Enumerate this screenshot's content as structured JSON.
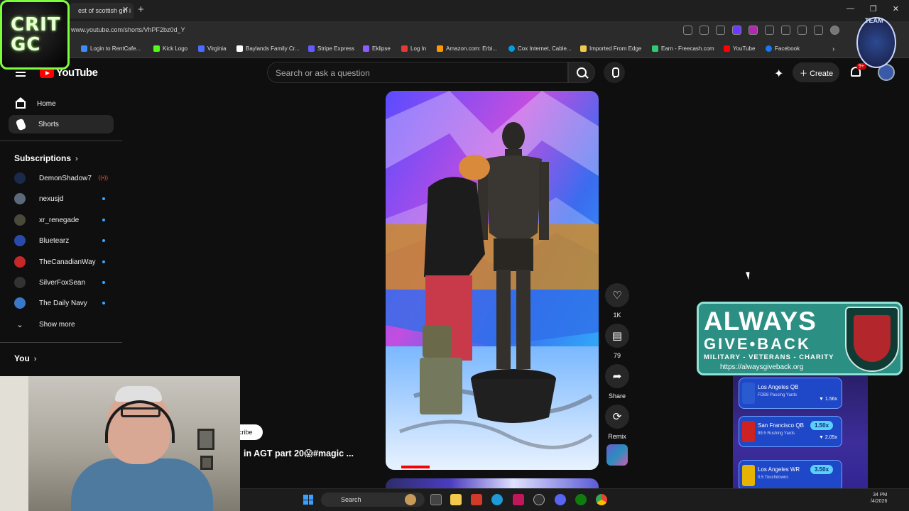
{
  "browser": {
    "tab_title": "est of scottish girl i",
    "url": "www.youtube.com/shorts/VhPF2bz0d_Y",
    "bookmarks": [
      {
        "label": "Login to RentCafe...",
        "color": "#3c8cff"
      },
      {
        "label": "Kick Logo",
        "color": "#53fc18"
      },
      {
        "label": "Virginia",
        "color": "#4a6cff"
      },
      {
        "label": "Baylands Family Cr...",
        "color": "#ffffff"
      },
      {
        "label": "Stripe Express",
        "color": "#635bff"
      },
      {
        "label": "Eklipse",
        "color": "#8c5cff"
      },
      {
        "label": "Log In",
        "color": "#e53935"
      },
      {
        "label": "Amazon.com: Erbi...",
        "color": "#ff9900"
      },
      {
        "label": "Cox Internet, Cable...",
        "color": "#00a0e0"
      },
      {
        "label": "Imported From Edge",
        "color": "#f2c94c"
      },
      {
        "label": "Earn - Freecash.com",
        "color": "#2ecc71"
      },
      {
        "label": "YouTube",
        "color": "#ff0000"
      },
      {
        "label": "Facebook",
        "color": "#1877f2"
      }
    ]
  },
  "youtube": {
    "logo_text": "YouTube",
    "search_placeholder": "Search or ask a question",
    "create_label": "Create",
    "notification_count": "9+"
  },
  "sidebar": {
    "nav": [
      {
        "label": "Home",
        "icon": "home-icon"
      },
      {
        "label": "Shorts",
        "icon": "shorts-icon"
      }
    ],
    "subscriptions_title": "Subscriptions",
    "subscriptions": [
      {
        "name": "DemonShadow7",
        "avatar_color": "#1b2a4a",
        "status": "live"
      },
      {
        "name": "nexusjd",
        "avatar_color": "#5a6a7a",
        "status": "new"
      },
      {
        "name": "xr_renegade",
        "avatar_color": "#4a4a3a",
        "status": "new"
      },
      {
        "name": "Bluetearz",
        "avatar_color": "#2a4aaa",
        "status": "new"
      },
      {
        "name": "TheCanadianWay",
        "avatar_color": "#c62828",
        "status": "new"
      },
      {
        "name": "SilverFoxSean",
        "avatar_color": "#333333",
        "status": "new"
      },
      {
        "name": "The Daily Navy",
        "avatar_color": "#3a78c8",
        "status": "new"
      }
    ],
    "show_more": "Show more",
    "you_title": "You"
  },
  "short": {
    "caption": "in AGT part 20😱#magic ...",
    "subscribe": "cribe",
    "likes": "1K",
    "comments": "79",
    "share": "Share",
    "remix": "Remix"
  },
  "overlays": {
    "crit_logo": "CRIT GC",
    "team_badge": "TEAM",
    "agb_always": "ALWAYS",
    "agb_give": "GIVE•BACK",
    "agb_sub": "MILITARY - VETERANS - CHARITY",
    "agb_url": "https://alwaysgiveback.org",
    "widget_cards": [
      {
        "name": "Los Angeles QB",
        "sub": "FDB8 Passing Yards",
        "pill": "",
        "sub2": "▼ 1.56x"
      },
      {
        "name": "San Francisco QB",
        "sub": "99.5 Rushing Yards",
        "pill": "1.50x",
        "sub2": "▼ 2.05x"
      },
      {
        "name": "Los Angeles WR",
        "sub": "0.5 Touchdowns",
        "pill": "3.50x",
        "sub2": ""
      }
    ]
  },
  "taskbar": {
    "search_label": "Search",
    "time": "34 PM",
    "date": "/4/2026"
  }
}
